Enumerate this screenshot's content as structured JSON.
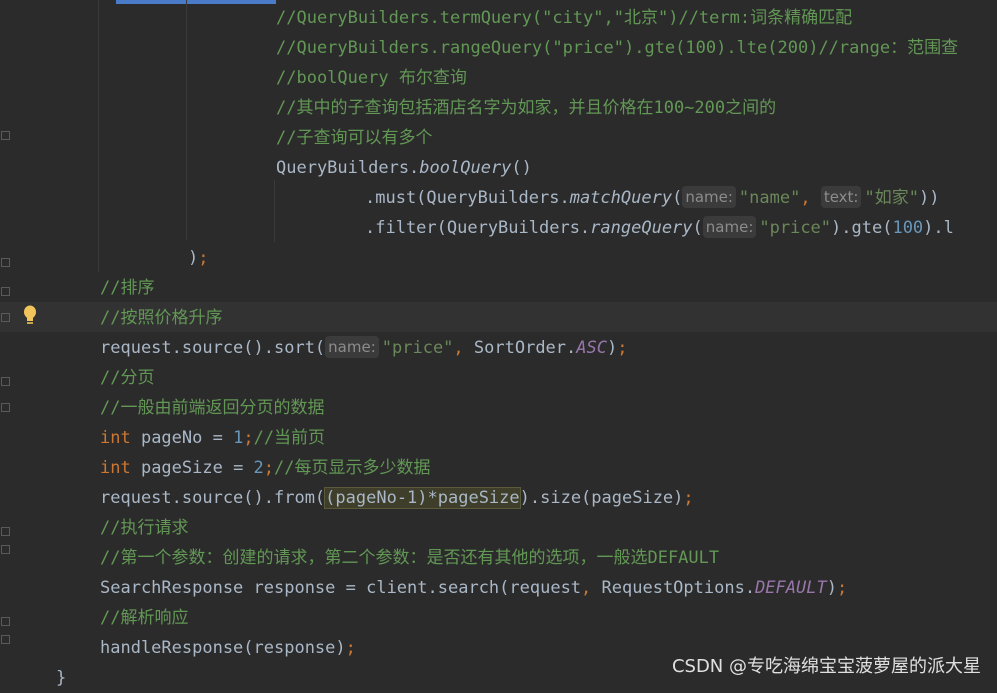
{
  "editor": {
    "lines": [
      {
        "id": "l1",
        "segments": [
          {
            "c": "cm",
            "t": "//QueryBuilders.termQuery(\"city\",\"北京\")//term:词条精确匹配"
          }
        ]
      },
      {
        "id": "l2",
        "segments": [
          {
            "c": "cm",
            "t": "//QueryBuilders.rangeQuery(\"price\").gte(100).lte(200)//range：范围查"
          }
        ]
      },
      {
        "id": "l3",
        "segments": [
          {
            "c": "cm",
            "t": "//boolQuery 布尔查询"
          }
        ]
      },
      {
        "id": "l4",
        "segments": [
          {
            "c": "cm",
            "t": "//其中的子查询包括酒店名字为如家，并且价格在100~200之间的"
          }
        ]
      },
      {
        "id": "l5",
        "segments": [
          {
            "c": "cm",
            "t": "//子查询可以有多个"
          }
        ]
      },
      {
        "id": "l6",
        "segments": [
          {
            "c": "",
            "t": "QueryBuilders."
          },
          {
            "c": "it",
            "t": "boolQuery"
          },
          {
            "c": "",
            "t": "()"
          }
        ]
      },
      {
        "id": "l7",
        "segments": [
          {
            "c": "",
            "t": ".must(QueryBuilders."
          },
          {
            "c": "it",
            "t": "matchQuery"
          },
          {
            "c": "",
            "t": "("
          },
          {
            "c": "hint",
            "t": "name:"
          },
          {
            "c": "str",
            "t": "\"name\""
          },
          {
            "c": "kw",
            "t": ", "
          },
          {
            "c": "hint",
            "t": "text:"
          },
          {
            "c": "str",
            "t": "\"如家\""
          },
          {
            "c": "",
            "t": "))"
          }
        ]
      },
      {
        "id": "l8",
        "segments": [
          {
            "c": "",
            "t": ".filter(QueryBuilders."
          },
          {
            "c": "it",
            "t": "rangeQuery"
          },
          {
            "c": "",
            "t": "("
          },
          {
            "c": "hint",
            "t": "name:"
          },
          {
            "c": "str",
            "t": "\"price\""
          },
          {
            "c": "",
            "t": ").gte("
          },
          {
            "c": "num",
            "t": "100"
          },
          {
            "c": "",
            "t": ").l"
          }
        ]
      },
      {
        "id": "l9",
        "segments": [
          {
            "c": "",
            "t": ")"
          },
          {
            "c": "kw",
            "t": ";"
          }
        ]
      },
      {
        "id": "l10",
        "segments": [
          {
            "c": "cm",
            "t": "//排序"
          }
        ]
      },
      {
        "id": "l11",
        "segments": [
          {
            "c": "cm",
            "t": "//按照价格升序"
          }
        ]
      },
      {
        "id": "l12",
        "segments": [
          {
            "c": "",
            "t": "request.source().sort("
          },
          {
            "c": "hint",
            "t": "name:"
          },
          {
            "c": "str",
            "t": "\"price\""
          },
          {
            "c": "kw",
            "t": ", "
          },
          {
            "c": "",
            "t": "SortOrder."
          },
          {
            "c": "const",
            "t": "ASC"
          },
          {
            "c": "",
            "t": ")"
          },
          {
            "c": "kw",
            "t": ";"
          }
        ]
      },
      {
        "id": "l13",
        "segments": [
          {
            "c": "cm",
            "t": "//分页"
          }
        ]
      },
      {
        "id": "l14",
        "segments": [
          {
            "c": "cm",
            "t": "//一般由前端返回分页的数据"
          }
        ]
      },
      {
        "id": "l15",
        "segments": [
          {
            "c": "kw",
            "t": "int "
          },
          {
            "c": "",
            "t": "pageNo = "
          },
          {
            "c": "num",
            "t": "1"
          },
          {
            "c": "kw",
            "t": ";"
          },
          {
            "c": "cm",
            "t": "//当前页"
          }
        ]
      },
      {
        "id": "l16",
        "segments": [
          {
            "c": "kw",
            "t": "int "
          },
          {
            "c": "",
            "t": "pageSize = "
          },
          {
            "c": "num",
            "t": "2"
          },
          {
            "c": "kw",
            "t": ";"
          },
          {
            "c": "cm",
            "t": "//每页显示多少数据"
          }
        ]
      },
      {
        "id": "l17",
        "segments": [
          {
            "c": "",
            "t": "request.source().from("
          },
          {
            "c": "sel",
            "t": "(pageNo-1)*pageSize"
          },
          {
            "c": "",
            "t": ").size(pageSize)"
          },
          {
            "c": "kw",
            "t": ";"
          }
        ]
      },
      {
        "id": "l18",
        "segments": [
          {
            "c": "cm",
            "t": "//执行请求"
          }
        ]
      },
      {
        "id": "l19",
        "segments": [
          {
            "c": "cm",
            "t": "//第一个参数：创建的请求，第二个参数：是否还有其他的选项，一般选DEFAULT"
          }
        ]
      },
      {
        "id": "l20",
        "segments": [
          {
            "c": "",
            "t": "SearchResponse response = client.search(request"
          },
          {
            "c": "kw",
            "t": ", "
          },
          {
            "c": "",
            "t": "RequestOptions."
          },
          {
            "c": "const",
            "t": "DEFAULT"
          },
          {
            "c": "",
            "t": ")"
          },
          {
            "c": "kw",
            "t": ";"
          }
        ]
      },
      {
        "id": "l21",
        "segments": [
          {
            "c": "cm",
            "t": "//解析响应"
          }
        ]
      },
      {
        "id": "l22",
        "segments": [
          {
            "c": "",
            "t": "handleResponse(response)"
          },
          {
            "c": "kw",
            "t": ";"
          }
        ]
      },
      {
        "id": "l23",
        "segments": [
          {
            "c": "",
            "t": "}"
          }
        ]
      }
    ]
  },
  "gutter": {
    "intention_icon": "lightbulb-icon",
    "fold_icon": "fold-marker-icon"
  },
  "watermark": {
    "text": "CSDN @专吃海绵宝宝菠萝屋的派大星"
  },
  "colors": {
    "background": "#2b2b2b",
    "comment": "#629755",
    "keyword": "#cc7832",
    "string": "#6a8759",
    "number": "#6897bb",
    "constant": "#9876aa"
  }
}
